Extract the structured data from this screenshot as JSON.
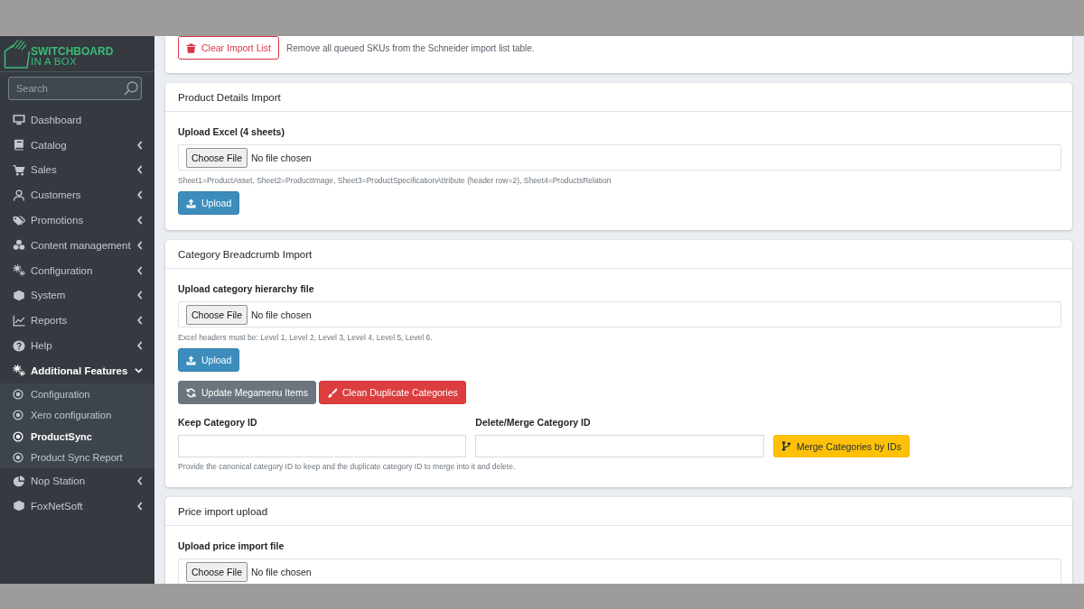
{
  "sidebar": {
    "brand": {
      "name": "SWITCHBOARD",
      "tagline": "IN A BOX"
    },
    "search": {
      "placeholder": "Search"
    },
    "items": [
      {
        "label": "Dashboard",
        "kind": "link"
      },
      {
        "label": "Catalog",
        "kind": "group",
        "expanded": false
      },
      {
        "label": "Sales",
        "kind": "group",
        "expanded": false
      },
      {
        "label": "Customers",
        "kind": "group",
        "expanded": false
      },
      {
        "label": "Promotions",
        "kind": "group",
        "expanded": false
      },
      {
        "label": "Content management",
        "kind": "group",
        "expanded": false
      },
      {
        "label": "Configuration",
        "kind": "group",
        "expanded": false
      },
      {
        "label": "System",
        "kind": "group",
        "expanded": false
      },
      {
        "label": "Reports",
        "kind": "group",
        "expanded": false
      },
      {
        "label": "Help",
        "kind": "group",
        "expanded": false
      },
      {
        "label": "Additional Features",
        "kind": "group",
        "expanded": true,
        "children": [
          {
            "label": "Configuration",
            "selected": false
          },
          {
            "label": "Xero configuration",
            "selected": false
          },
          {
            "label": "ProductSync",
            "selected": true
          },
          {
            "label": "Product Sync Report",
            "selected": false
          }
        ]
      },
      {
        "label": "Nop Station",
        "kind": "group",
        "expanded": false
      },
      {
        "label": "FoxNetSoft",
        "kind": "group",
        "expanded": false
      }
    ]
  },
  "cards": [
    {
      "blocks": [
        {
          "kind": "note_action",
          "button": {
            "label": "Clear Import List",
            "kind": "clear"
          },
          "text": "Remove all queued SKUs from the Schneider import list table."
        }
      ]
    },
    {
      "title": "Product Details Import",
      "blocks": [
        {
          "kind": "file_upload",
          "label": "Upload Excel (4 sheets)",
          "file_input": {
            "button": "Choose File",
            "status": "No file chosen"
          },
          "hint": "Sheet1=ProductAsset, Sheet2=ProductImage, Sheet3=ProductSpecificationAttribute (header row=2), Sheet4=ProductsRelation"
        },
        {
          "kind": "button",
          "button": {
            "label": "Upload",
            "kind": "upload"
          }
        }
      ]
    },
    {
      "title": "Category Breadcrumb Import",
      "blocks": [
        {
          "kind": "file_upload",
          "label": "Upload category hierarchy file",
          "file_input": {
            "button": "Choose File",
            "status": "No file chosen"
          },
          "hint": "Excel headers must be: Level 1, Level 2, Level 3, Level 4, Level 5, Level 6."
        },
        {
          "kind": "button",
          "button": {
            "label": "Upload",
            "kind": "upload"
          }
        },
        {
          "kind": "button_row",
          "buttons": [
            {
              "label": "Update Megamenu Items",
              "kind": "update"
            },
            {
              "label": "Clean Duplicate Categories",
              "kind": "clean"
            }
          ]
        },
        {
          "kind": "id_merge",
          "fields": [
            {
              "label": "Keep Category ID"
            },
            {
              "label": "Delete/Merge Category ID"
            }
          ],
          "button": {
            "label": "Merge Categories by IDs",
            "kind": "merge"
          },
          "hint": "Provide the canonical category ID to keep and the duplicate category ID to merge into it and delete."
        }
      ]
    },
    {
      "title": "Price import upload",
      "blocks": [
        {
          "kind": "file_upload",
          "label": "Upload price import file",
          "file_input": {
            "button": "Choose File",
            "status": "No file chosen"
          }
        }
      ]
    }
  ]
}
